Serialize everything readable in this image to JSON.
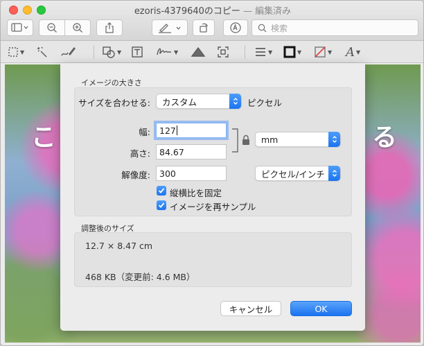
{
  "window": {
    "title": "ezoris-4379640のコピー",
    "title_suffix": " — 編集済み"
  },
  "toolbar": {
    "search_placeholder": "検索",
    "icons": [
      "sidebar-icon",
      "zoom-out-icon",
      "zoom-in-icon",
      "share-icon",
      "markup-pen-icon",
      "rotate-icon",
      "annotate-icon",
      "search-icon"
    ]
  },
  "markup_toolbar": {
    "icons": [
      "selection-icon",
      "instant-alpha-icon",
      "sketch-icon",
      "shapes-icon",
      "text-icon",
      "sign-icon",
      "adjust-color-icon",
      "adjust-size-icon",
      "line-style-icon",
      "border-color-icon",
      "fill-color-icon",
      "text-style-icon"
    ]
  },
  "background": {
    "text_left": "こ",
    "text_right": "る"
  },
  "dialog": {
    "image_size_heading": "イメージの大きさ",
    "fit_label": "サイズを合わせる:",
    "fit_value": "カスタム",
    "fit_unit": "ピクセル",
    "width_label": "幅:",
    "width_value": "127",
    "height_label": "高さ:",
    "height_value": "84.67",
    "resolution_label": "解像度:",
    "resolution_value": "300",
    "unit_value": "mm",
    "resolution_unit_value": "ピクセル/インチ",
    "scale_proportionally_label": "縦横比を固定",
    "resample_label": "イメージを再サンプル",
    "resulting_heading": "調整後のサイズ",
    "resulting_dimensions": "12.7 × 8.47 cm",
    "resulting_filesize": "468 KB（変更前: 4.6 MB）",
    "cancel_label": "キャンセル",
    "ok_label": "OK"
  }
}
